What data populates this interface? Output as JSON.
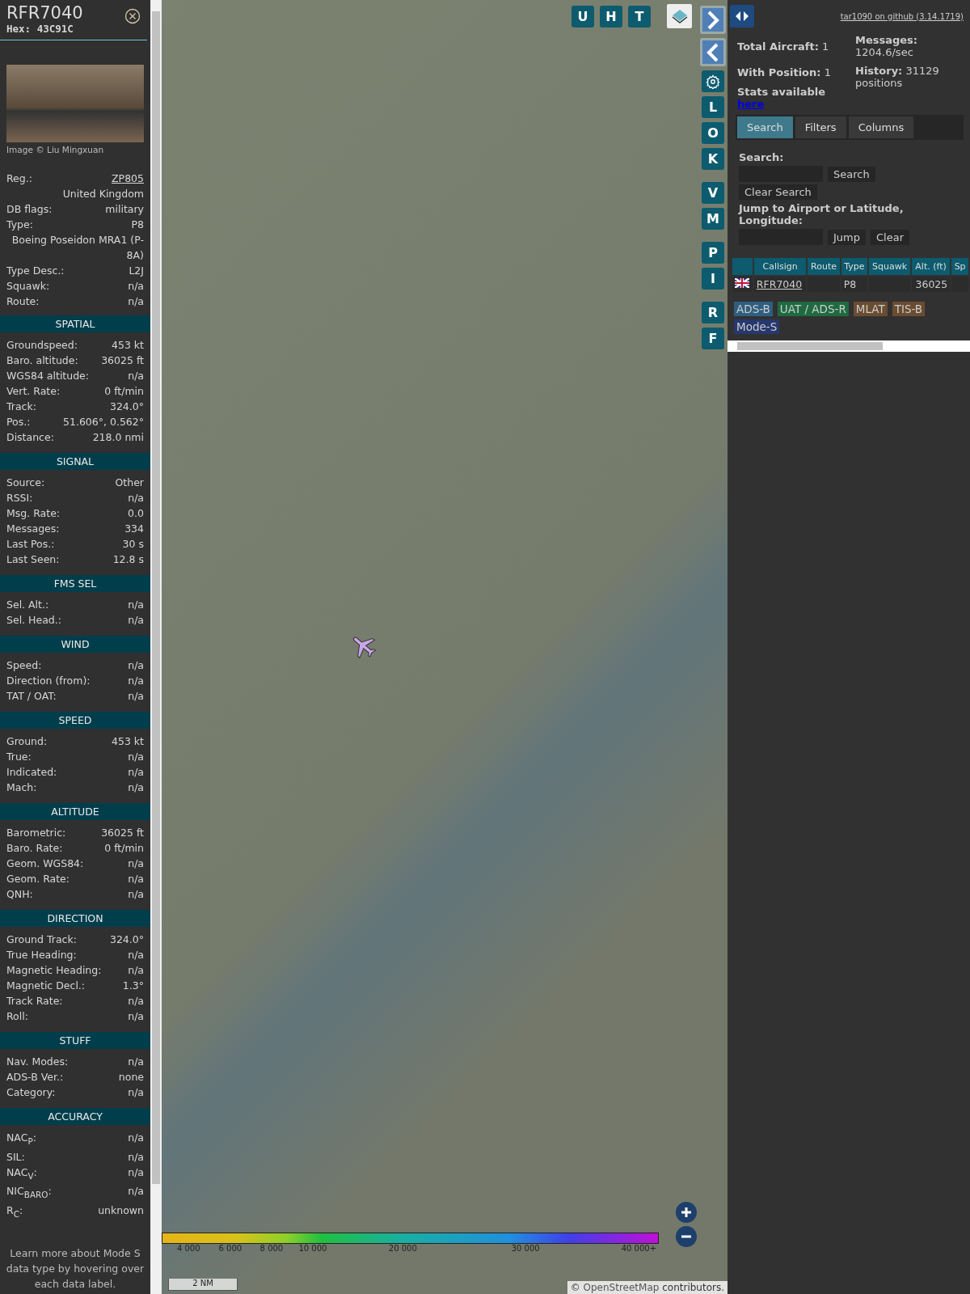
{
  "aircraft": {
    "callsign": "RFR7040",
    "hex_label": "Hex:",
    "hex": "43C91C",
    "photo_credit": "Image © Liu Mingxuan"
  },
  "info_rows": [
    {
      "kind": "link",
      "label": "Reg.:",
      "value": "ZP805"
    },
    {
      "kind": "value_only",
      "value": "United Kingdom"
    },
    {
      "kind": "pair",
      "label": "DB flags:",
      "value": "military"
    },
    {
      "kind": "pair",
      "label": "Type:",
      "value": "P8"
    },
    {
      "kind": "value_only",
      "value": "Boeing Poseidon MRA1 (P-8A)"
    },
    {
      "kind": "pair",
      "label": "Type Desc.:",
      "value": "L2J"
    },
    {
      "kind": "pair",
      "label": "Squawk:",
      "value": "n/a"
    },
    {
      "kind": "pair",
      "label": "Route:",
      "value": "n/a"
    }
  ],
  "sections": [
    {
      "title": "SPATIAL",
      "rows": [
        {
          "label": "Groundspeed:",
          "value": "453 kt"
        },
        {
          "label": "Baro. altitude:",
          "value": "36025 ft"
        },
        {
          "label": "WGS84 altitude:",
          "value": "n/a"
        },
        {
          "label": "Vert. Rate:",
          "value": "0 ft/min"
        },
        {
          "label": "Track:",
          "value": "324.0°"
        },
        {
          "label": "Pos.:",
          "value": "51.606°, 0.562°"
        },
        {
          "label": "Distance:",
          "value": "218.0 nmi"
        }
      ]
    },
    {
      "title": "SIGNAL",
      "rows": [
        {
          "label": "Source:",
          "value": "Other"
        },
        {
          "label": "RSSI:",
          "value": "n/a"
        },
        {
          "label": "Msg. Rate:",
          "value": "0.0"
        },
        {
          "label": "Messages:",
          "value": "334"
        },
        {
          "label": "Last Pos.:",
          "value": "30 s"
        },
        {
          "label": "Last Seen:",
          "value": "12.8 s"
        }
      ]
    },
    {
      "title": "FMS SEL",
      "rows": [
        {
          "label": "Sel. Alt.:",
          "value": "n/a"
        },
        {
          "label": "Sel. Head.:",
          "value": "n/a"
        }
      ]
    },
    {
      "title": "WIND",
      "rows": [
        {
          "label": "Speed:",
          "value": "n/a"
        },
        {
          "label": "Direction (from):",
          "value": "n/a"
        },
        {
          "label": "TAT / OAT:",
          "value": "n/a"
        }
      ]
    },
    {
      "title": "SPEED",
      "rows": [
        {
          "label": "Ground:",
          "value": "453 kt"
        },
        {
          "label": "True:",
          "value": "n/a"
        },
        {
          "label": "Indicated:",
          "value": "n/a"
        },
        {
          "label": "Mach:",
          "value": "n/a"
        }
      ]
    },
    {
      "title": "ALTITUDE",
      "rows": [
        {
          "label": "Barometric:",
          "value": "36025 ft"
        },
        {
          "label": "Baro. Rate:",
          "value": "0 ft/min"
        },
        {
          "label": "Geom. WGS84:",
          "value": "n/a"
        },
        {
          "label": "Geom. Rate:",
          "value": "n/a"
        },
        {
          "label": "QNH:",
          "value": "n/a"
        }
      ]
    },
    {
      "title": "DIRECTION",
      "rows": [
        {
          "label": "Ground Track:",
          "value": "324.0°"
        },
        {
          "label": "True Heading:",
          "value": "n/a"
        },
        {
          "label": "Magnetic Heading:",
          "value": "n/a"
        },
        {
          "label": "Magnetic Decl.:",
          "value": "1.3°"
        },
        {
          "label": "Track Rate:",
          "value": "n/a"
        },
        {
          "label": "Roll:",
          "value": "n/a"
        }
      ]
    },
    {
      "title": "STUFF",
      "rows": [
        {
          "label": "Nav. Modes:",
          "value": "n/a"
        },
        {
          "label": "ADS-B Ver.:",
          "value": "none"
        },
        {
          "label": "Category:",
          "value": "n/a"
        }
      ]
    },
    {
      "title": "ACCURACY",
      "rows": [
        {
          "label": "NAC$_{P}$:",
          "value": "n/a"
        },
        {
          "label": "SIL:",
          "value": "n/a"
        },
        {
          "label": "NAC$_{V}$:",
          "value": "n/a"
        },
        {
          "label": "NIC$_{BARO}$:",
          "value": "n/a"
        },
        {
          "label": "R$_{C}$:",
          "value": "unknown"
        }
      ]
    }
  ],
  "help_note": "Learn more about Mode S data type by hovering over each data label.",
  "map": {
    "top_buttons": [
      "U",
      "H",
      "T"
    ],
    "letter_groups": [
      [
        "L",
        "O",
        "K"
      ],
      [
        "V",
        "M"
      ],
      [
        "P",
        "I"
      ],
      [
        "R",
        "F"
      ]
    ],
    "altitude_ticks": [
      "4 000",
      "6 000",
      "8 000",
      "10 000",
      "20 000",
      "30 000",
      "40 000+"
    ],
    "scale": "2 NM",
    "attribution": {
      "prefix": "©",
      "link": "OpenStreetMap",
      "suffix": "contributors."
    }
  },
  "sidebar": {
    "version_link": "tar1090 on github (3.14.1719)",
    "stats_left": [
      "**Total Aircraft:** 1",
      "**With Position:** 1"
    ],
    "stats_right": [
      "**Messages:** 1204.6/sec",
      "**History:** 31129 positions"
    ],
    "stats_note": "Stats available",
    "stats_link": "here",
    "tabs": [
      {
        "label": "Search",
        "selected": true
      },
      {
        "label": "Filters",
        "selected": false
      },
      {
        "label": "Columns",
        "selected": false
      }
    ],
    "search_label": "Search:",
    "search_button": "Search",
    "clear_search_button": "Clear Search",
    "jump_label": "Jump to Airport or Latitude, Longitude:",
    "jump_button": "Jump",
    "clear_button": "Clear",
    "table": {
      "columns": [
        "Callsign",
        "Route",
        "Type",
        "Squawk",
        "Alt. (ft)",
        "Sp"
      ],
      "rows": [
        {
          "cells": [
            "RFR7040",
            null,
            "P8",
            null,
            "36025",
            null
          ]
        }
      ]
    },
    "legend": [
      {
        "label": "ADS-B",
        "color": "#2e5f80"
      },
      {
        "label": "UAT / ADS-R",
        "color": "#1f6a40"
      },
      {
        "label": "MLAT",
        "color": "#6a4c30"
      },
      {
        "label": "TIS-B",
        "color": "#6a4c30"
      },
      {
        "label": "Mode-S",
        "color": "#27386f"
      }
    ]
  }
}
